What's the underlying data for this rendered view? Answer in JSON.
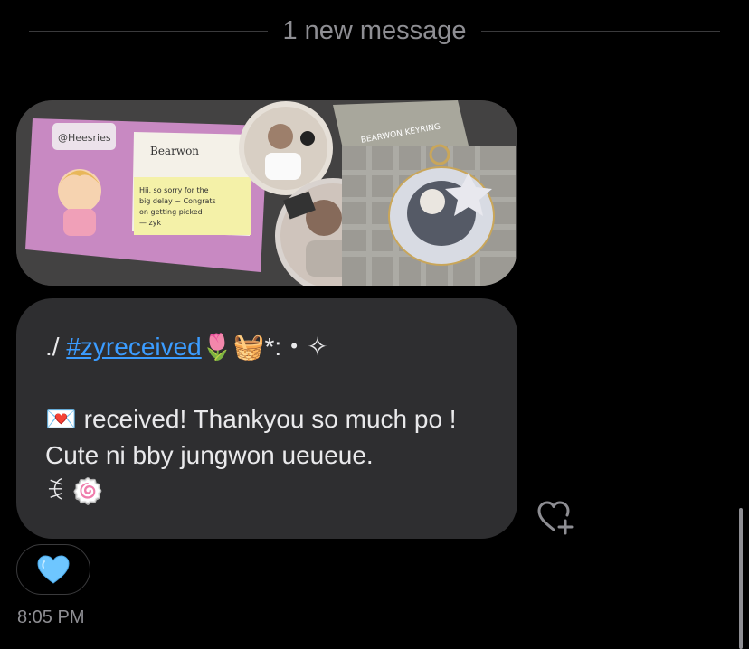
{
  "divider": {
    "text": "1 new message"
  },
  "photo": {
    "card_handle": "@Heesries",
    "card_title": "Bearwon",
    "card_note": "Hii, so sorry for the big delay Congrats on getting picked ~ zyk",
    "keyring_label": "BEARWON KEYRING"
  },
  "message": {
    "prefix": "./ ",
    "hashtag": "#zyreceived",
    "after_hashtag": "🌷🧺*:・✧",
    "envelope": "💌",
    "body": " received! Thankyou so much po ! Cute ni bby jungwon ueueue.",
    "suffix": "ꉂ 🍥"
  },
  "reaction": {
    "emoji": "🩵"
  },
  "timestamp": "8:05 PM",
  "icons": {
    "add_reaction": "heart-plus-icon",
    "reaction": "light-blue-heart-icon"
  },
  "colors": {
    "background": "#000000",
    "bubble": "#2e2e30",
    "link": "#3b9cff",
    "muted": "#8e8e93",
    "reaction_heart": "#6ec6ff"
  }
}
